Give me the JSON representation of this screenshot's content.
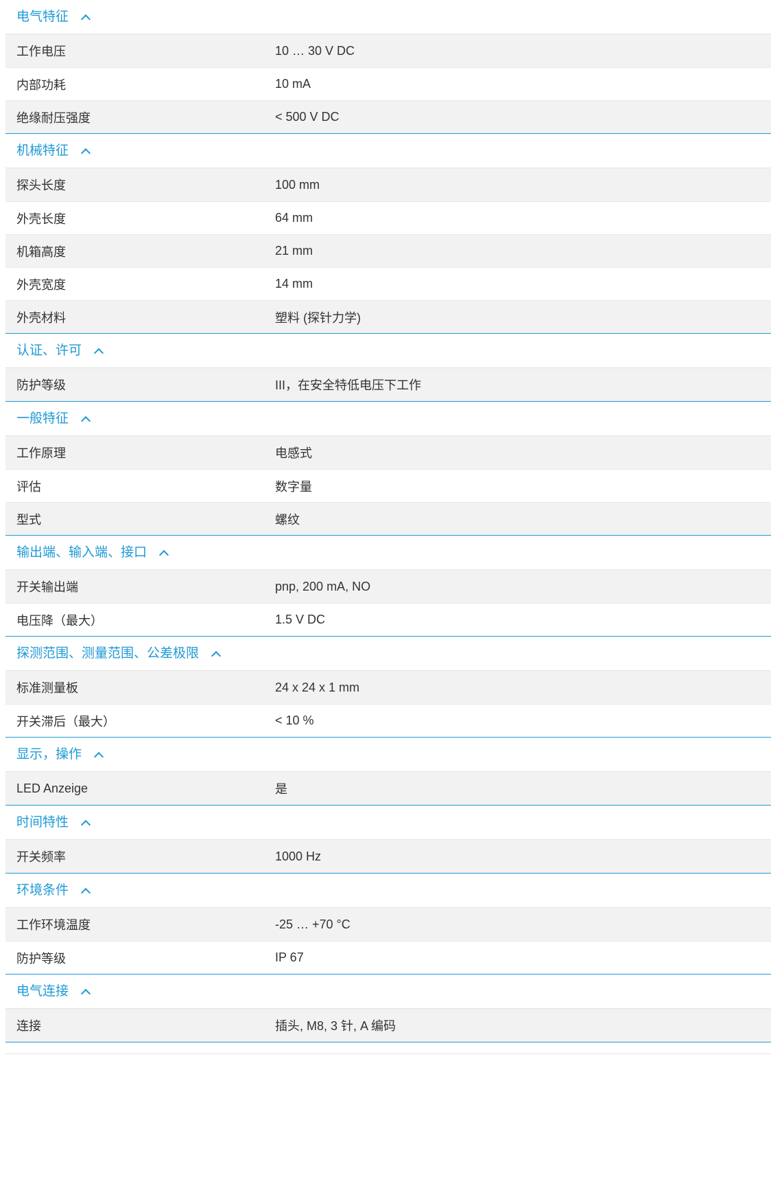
{
  "sections": [
    {
      "title": "电气特征",
      "rows": [
        {
          "label": "工作电压",
          "value": "10 … 30 V DC"
        },
        {
          "label": "内部功耗",
          "value": "10 mA"
        },
        {
          "label": "绝缘耐压强度",
          "value": "< 500 V DC"
        }
      ]
    },
    {
      "title": "机械特征",
      "rows": [
        {
          "label": "探头长度",
          "value": "100 mm"
        },
        {
          "label": "外壳长度",
          "value": "64 mm"
        },
        {
          "label": "机箱高度",
          "value": "21 mm"
        },
        {
          "label": "外壳宽度",
          "value": "14 mm"
        },
        {
          "label": "外壳材料",
          "value": "塑料 (探针力学)"
        }
      ]
    },
    {
      "title": "认证、许可",
      "rows": [
        {
          "label": "防护等级",
          "value": "III，在安全特低电压下工作"
        }
      ]
    },
    {
      "title": "一般特征",
      "rows": [
        {
          "label": "工作原理",
          "value": "电感式"
        },
        {
          "label": "评估",
          "value": "数字量"
        },
        {
          "label": "型式",
          "value": "螺纹"
        }
      ]
    },
    {
      "title": "输出端、输入端、接口",
      "rows": [
        {
          "label": "开关输出端",
          "value": "pnp, 200 mA, NO"
        },
        {
          "label": "电压降（最大）",
          "value": "1.5 V DC"
        }
      ]
    },
    {
      "title": "探测范围、测量范围、公差极限",
      "rows": [
        {
          "label": "标准测量板",
          "value": "24 x 24 x 1 mm"
        },
        {
          "label": "开关滞后（最大）",
          "value": "< 10 %"
        }
      ]
    },
    {
      "title": "显示，操作",
      "rows": [
        {
          "label": "LED Anzeige",
          "value": "是"
        }
      ]
    },
    {
      "title": "时间特性",
      "rows": [
        {
          "label": "开关频率",
          "value": "1000 Hz"
        }
      ]
    },
    {
      "title": "环境条件",
      "rows": [
        {
          "label": "工作环境温度",
          "value": "-25 … +70 °C"
        },
        {
          "label": "防护等级",
          "value": "IP 67"
        }
      ]
    },
    {
      "title": "电气连接",
      "rows": [
        {
          "label": "连接",
          "value": "插头, M8, 3 针, A 编码"
        }
      ]
    }
  ],
  "icons": {
    "section_toggle": "chevron-up-icon"
  },
  "colors": {
    "accent": "#1f9ad6",
    "row_shade": "#f2f2f2",
    "text": "#333333"
  }
}
